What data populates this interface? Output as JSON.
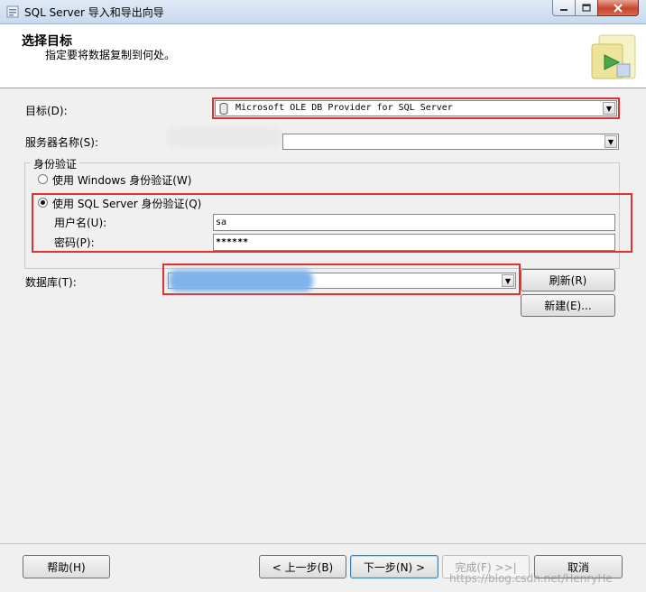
{
  "window": {
    "title": "SQL Server 导入和导出向导"
  },
  "header": {
    "title": "选择目标",
    "subtitle": "指定要将数据复制到何处。"
  },
  "form": {
    "destination_label": "目标(D):",
    "destination_value": "Microsoft OLE DB Provider for SQL Server",
    "server_label": "服务器名称(S):",
    "server_value": "",
    "auth_group_label": "身份验证",
    "windows_auth_label": "使用 Windows 身份验证(W)",
    "sql_auth_label": "使用 SQL Server 身份验证(Q)",
    "selected_auth": "sql",
    "username_label": "用户名(U):",
    "username_value": "sa",
    "password_label": "密码(P):",
    "password_value": "******",
    "database_label": "数据库(T):",
    "database_value": ""
  },
  "buttons": {
    "refresh": "刷新(R)",
    "new": "新建(E)...",
    "help": "帮助(H)",
    "back": "< 上一步(B)",
    "next": "下一步(N) >",
    "finish": "完成(F) >>|",
    "cancel": "取消"
  },
  "watermark": "https://blog.csdn.net/HenryHe"
}
